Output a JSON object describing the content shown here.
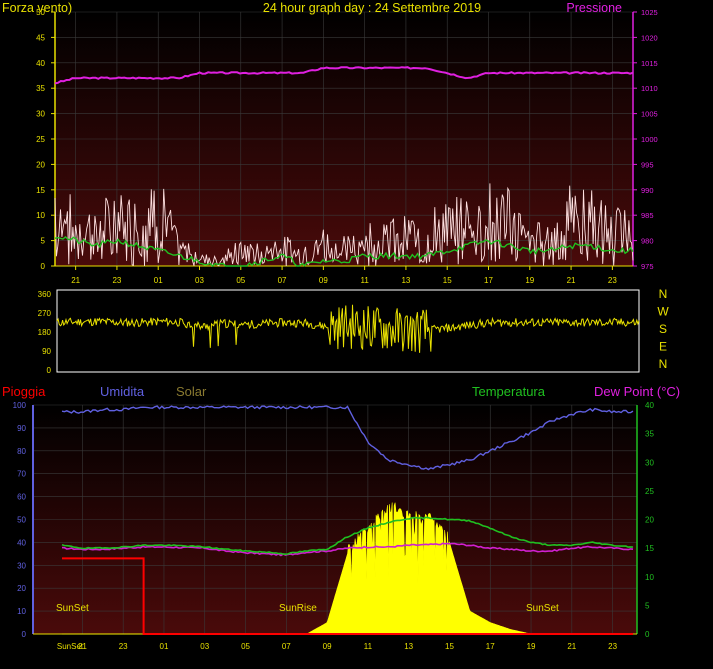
{
  "panel_top": {
    "title": "24 hour graph day : 24 Settembre 2019",
    "left_label": "Forza vento)",
    "right_label": "Pressione",
    "wind_ticks": [
      "50",
      "45",
      "40",
      "35",
      "30",
      "25",
      "20",
      "15",
      "10",
      "5",
      "0"
    ],
    "pressure_ticks": [
      "1025",
      "1020",
      "1015",
      "1010",
      "1005",
      "1000",
      "995",
      "990",
      "985",
      "980",
      "975"
    ],
    "time_ticks": [
      "21",
      "23",
      "01",
      "03",
      "05",
      "07",
      "09",
      "11",
      "13",
      "15",
      "17",
      "19",
      "21",
      "23"
    ]
  },
  "panel_dir": {
    "ticks": [
      "360",
      "270",
      "180",
      "90",
      "0"
    ],
    "compass": [
      "N",
      "W",
      "S",
      "E",
      "N"
    ]
  },
  "panel_bottom": {
    "label_rain": "Pioggia",
    "label_humidity": "Umidita",
    "label_solar": "Solar",
    "label_temp": "Temperatura",
    "label_dew": "Dew Point (°C)",
    "left_ticks": [
      "100",
      "90",
      "80",
      "70",
      "60",
      "50",
      "40",
      "30",
      "20",
      "10",
      "0"
    ],
    "right_ticks": [
      "40",
      "35",
      "30",
      "25",
      "20",
      "15",
      "10",
      "5",
      "0"
    ],
    "time_ticks": [
      "SunSet",
      "21",
      "23",
      "01",
      "03",
      "05",
      "07",
      "09",
      "11",
      "13",
      "15",
      "17",
      "19",
      "21",
      "23"
    ],
    "annotations": [
      "SunSet",
      "SunRise",
      "SunSet"
    ]
  },
  "colors": {
    "pressure": "#e020e0",
    "gust": "#ffe0e0",
    "wind": "#20c020",
    "direction": "#e8e000",
    "humidity": "#6060e0",
    "temperature": "#20c020",
    "dew": "#d020d0",
    "solar": "#ffff00",
    "rain": "#ff0000",
    "axis": "#e8e000"
  },
  "chart_data": [
    {
      "type": "line",
      "title": "24 hour graph day : 24 Settembre 2019",
      "ylabel": "Forza vento)",
      "y2label": "Pressione",
      "x": [
        "20",
        "21",
        "22",
        "23",
        "00",
        "01",
        "02",
        "03",
        "04",
        "05",
        "06",
        "07",
        "08",
        "09",
        "10",
        "11",
        "12",
        "13",
        "14",
        "15",
        "16",
        "17",
        "18",
        "19",
        "20",
        "21",
        "22",
        "23",
        "24"
      ],
      "ylim": [
        0,
        50
      ],
      "y2lim": [
        975,
        1025
      ],
      "series": [
        {
          "name": "Pressione",
          "axis": "right",
          "values": [
            1011,
            1012,
            1012,
            1012,
            1012,
            1012,
            1012,
            1013,
            1013,
            1013,
            1013,
            1013,
            1013,
            1014,
            1014,
            1014,
            1014,
            1014,
            1014,
            1013,
            1012,
            1013,
            1013,
            1013,
            1013,
            1013,
            1013,
            1013,
            1013
          ]
        },
        {
          "name": "Forza vento)",
          "axis": "left",
          "values": [
            6,
            5,
            4,
            5,
            4,
            3,
            2,
            1,
            0,
            0,
            1,
            2,
            0,
            1,
            1,
            2,
            2,
            2,
            2,
            3,
            4,
            5,
            4,
            3,
            3,
            4,
            4,
            3,
            3
          ]
        },
        {
          "values": [
            16,
            12,
            11,
            14,
            12,
            18,
            5,
            3,
            2,
            5,
            4,
            6,
            3,
            7,
            6,
            8,
            9,
            9,
            10,
            12,
            13,
            16,
            14,
            8,
            8,
            15,
            14,
            11,
            10
          ]
        }
      ]
    },
    {
      "type": "line",
      "x": [
        "20",
        "21",
        "22",
        "23",
        "00",
        "01",
        "02",
        "03",
        "04",
        "05",
        "06",
        "07",
        "08",
        "09",
        "10",
        "11",
        "12",
        "13",
        "14",
        "15",
        "16",
        "17",
        "18",
        "19",
        "20",
        "21",
        "22",
        "23",
        "24"
      ],
      "ylim": [
        0,
        360
      ],
      "series": [
        {
          "values": [
            225,
            228,
            230,
            225,
            225,
            230,
            225,
            205,
            220,
            215,
            220,
            225,
            222,
            205,
            210,
            200,
            195,
            185,
            190,
            200,
            215,
            225,
            225,
            225,
            225,
            225,
            225,
            225,
            225
          ]
        }
      ]
    },
    {
      "type": "line",
      "x": [
        "20",
        "21",
        "22",
        "23",
        "00",
        "01",
        "02",
        "03",
        "04",
        "05",
        "06",
        "07",
        "08",
        "09",
        "10",
        "11",
        "12",
        "13",
        "14",
        "15",
        "16",
        "17",
        "18",
        "19",
        "20",
        "21",
        "22",
        "23",
        "24"
      ],
      "ylim": [
        0,
        100
      ],
      "y2lim": [
        0,
        40
      ],
      "series": [
        {
          "name": "Umidita",
          "axis": "left",
          "values": [
            97,
            97,
            98,
            98,
            99,
            99,
            99,
            99,
            99,
            99,
            99,
            99,
            99,
            99,
            99,
            84,
            76,
            74,
            72,
            74,
            76,
            80,
            84,
            88,
            93,
            96,
            98,
            97,
            97
          ]
        },
        {
          "name": "Temperatura",
          "axis": "right",
          "values": [
            15.5,
            15,
            15,
            15.2,
            15.5,
            15.5,
            15.4,
            15.2,
            14.8,
            14.5,
            14.3,
            14,
            14.5,
            14.8,
            17,
            18.5,
            19.5,
            20.2,
            20.3,
            20,
            19.8,
            18.5,
            17,
            16,
            15.5,
            15.5,
            16,
            15.5,
            15.2
          ]
        },
        {
          "name": "Dew Point (°C)",
          "axis": "right",
          "values": [
            15,
            14.8,
            14.8,
            15,
            15.2,
            15.2,
            15.1,
            15,
            14.5,
            14.2,
            14,
            13.8,
            14.3,
            14.5,
            15,
            15.2,
            15.2,
            15.5,
            15.6,
            15.8,
            15.5,
            15,
            14.8,
            14.5,
            14.5,
            15,
            15.2,
            15,
            14.8
          ]
        },
        {
          "name": "Solar",
          "axis": "left",
          "values": [
            0,
            0,
            0,
            0,
            0,
            0,
            0,
            0,
            0,
            0,
            0,
            0,
            0,
            5,
            35,
            45,
            55,
            50,
            50,
            40,
            10,
            5,
            2,
            0,
            0,
            0,
            0,
            0,
            0
          ]
        },
        {
          "name": "Pioggia",
          "axis": "left",
          "values": [
            33,
            33,
            33,
            33,
            0,
            0,
            0,
            0,
            0,
            0,
            0,
            0,
            0,
            0,
            0,
            0,
            0,
            0,
            0,
            0,
            0,
            0,
            0,
            0,
            0,
            0,
            0,
            0,
            0
          ]
        }
      ]
    }
  ]
}
